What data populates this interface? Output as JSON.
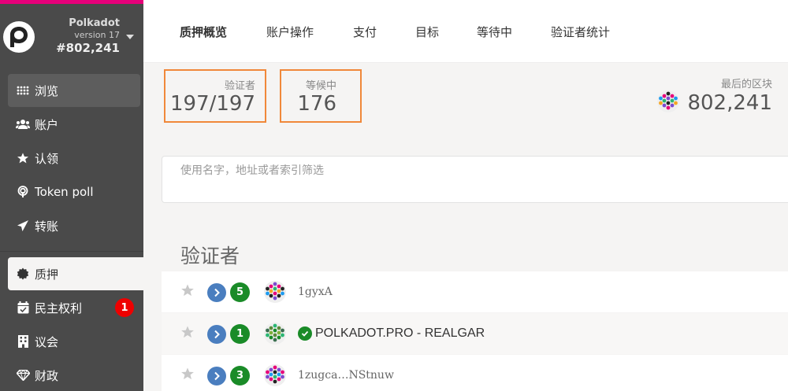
{
  "chain": {
    "name": "Polkadot",
    "version": "version 17",
    "block": "#802,241"
  },
  "sidebar": {
    "items": [
      {
        "label": "浏览",
        "icon": "grid-icon"
      },
      {
        "label": "账户",
        "icon": "users-icon"
      },
      {
        "label": "认领",
        "icon": "star-icon"
      },
      {
        "label": "Token poll",
        "icon": "podcast-icon"
      },
      {
        "label": "转账",
        "icon": "send-icon"
      },
      {
        "label": "质押",
        "icon": "certificate-icon"
      },
      {
        "label": "民主权利",
        "icon": "calendar-check-icon",
        "badge": "1"
      },
      {
        "label": "议会",
        "icon": "building-icon"
      },
      {
        "label": "财政",
        "icon": "diamond-icon"
      }
    ]
  },
  "tabs": [
    {
      "label": "质押概览"
    },
    {
      "label": "账户操作"
    },
    {
      "label": "支付"
    },
    {
      "label": "目标"
    },
    {
      "label": "等待中"
    },
    {
      "label": "验证者统计"
    }
  ],
  "summary": {
    "validators_label": "验证者",
    "validators_value": "197/197",
    "waiting_label": "等候中",
    "waiting_value": "176",
    "last_block_label": "最后的区块",
    "last_block_value": "802,241"
  },
  "filter": {
    "placeholder": "使用名字，地址或者索引筛选"
  },
  "section": {
    "title": "验证者"
  },
  "rows": [
    {
      "count": "5",
      "address": "1gyxA"
    },
    {
      "count": "1",
      "address": "POLKADOT.PRO - REALGAR"
    },
    {
      "count": "3",
      "address": "1zugca…NStnuw"
    }
  ],
  "colors": {
    "accent": "#e6007a",
    "highlight": "#f0883a",
    "sidebar": "#4a4a4a",
    "badge_green": "#1a8b28",
    "nominate_blue": "#4a7ebf"
  }
}
